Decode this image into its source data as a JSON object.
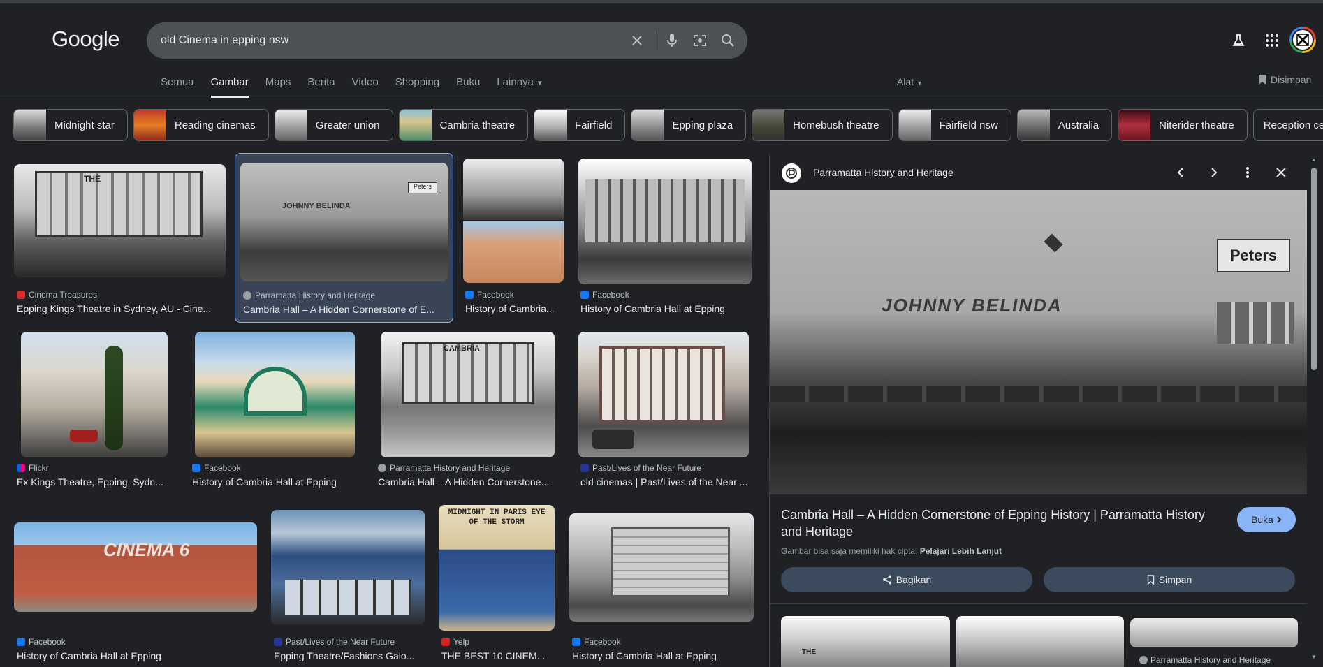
{
  "header": {
    "logo": "Google",
    "search_value": "old Cinema in epping nsw",
    "icons": [
      "close-icon",
      "mic-icon",
      "lens-icon",
      "search-icon",
      "labs-icon",
      "apps-icon"
    ]
  },
  "tabs": {
    "items": [
      "Semua",
      "Gambar",
      "Maps",
      "Berita",
      "Video",
      "Shopping",
      "Buku"
    ],
    "more": "Lainnya",
    "active": "Gambar",
    "tools": "Alat",
    "saved": "Disimpan"
  },
  "chips": [
    "Midnight star",
    "Reading cinemas",
    "Greater union",
    "Cambria theatre",
    "Fairfield",
    "Epping plaza",
    "Homebush theatre",
    "Fairfield nsw",
    "Australia",
    "Niterider theatre",
    "Reception centr"
  ],
  "results": [
    {
      "source": "Cinema Treasures",
      "caption": "Epping Kings Theatre in Sydney, AU - Cine..."
    },
    {
      "source": "Parramatta History and Heritage",
      "caption": "Cambria Hall – A Hidden Cornerstone of E..."
    },
    {
      "source": "Facebook",
      "caption": "History of Cambria..."
    },
    {
      "source": "Facebook",
      "caption": "History of Cambria Hall at Epping"
    },
    {
      "source": "Flickr",
      "caption": "Ex Kings Theatre, Epping, Sydn..."
    },
    {
      "source": "Facebook",
      "caption": "History of Cambria Hall at Epping"
    },
    {
      "source": "Parramatta History and Heritage",
      "caption": "Cambria Hall – A Hidden Cornerstone..."
    },
    {
      "source": "Past/Lives of the Near Future",
      "caption": "old cinemas | Past/Lives of the Near ..."
    },
    {
      "source": "Facebook",
      "caption": "History of Cambria Hall at Epping"
    },
    {
      "source": "Past/Lives of the Near Future",
      "caption": "Epping Theatre/Fashions Galo..."
    },
    {
      "source": "Yelp",
      "caption": "THE BEST 10 CINEM..."
    },
    {
      "source": "Facebook",
      "caption": "History of Cambria Hall at Epping"
    }
  ],
  "image_text": {
    "cinema6": "CINEMA 6",
    "midnight": "MIDNIGHT IN PARIS EYE OF THE STORM",
    "johnny": "JOHNNY BELINDA",
    "peters": "Peters",
    "the": "THE",
    "cambria": "CAMBRIA"
  },
  "panel": {
    "source": "Parramatta History and Heritage",
    "title": "Cambria Hall – A Hidden Cornerstone of Epping History | Parramatta History and Heritage",
    "open_label": "Buka",
    "copyright_text": "Gambar bisa saja memiliki hak cipta.",
    "learn_more": "Pelajari Lebih Lanjut",
    "share_label": "Bagikan",
    "save_label": "Simpan",
    "related_source": "Parramatta History and Heritage"
  },
  "colors": {
    "background": "#202124",
    "accent": "#8ab4f8",
    "selected_card": "#394457"
  }
}
